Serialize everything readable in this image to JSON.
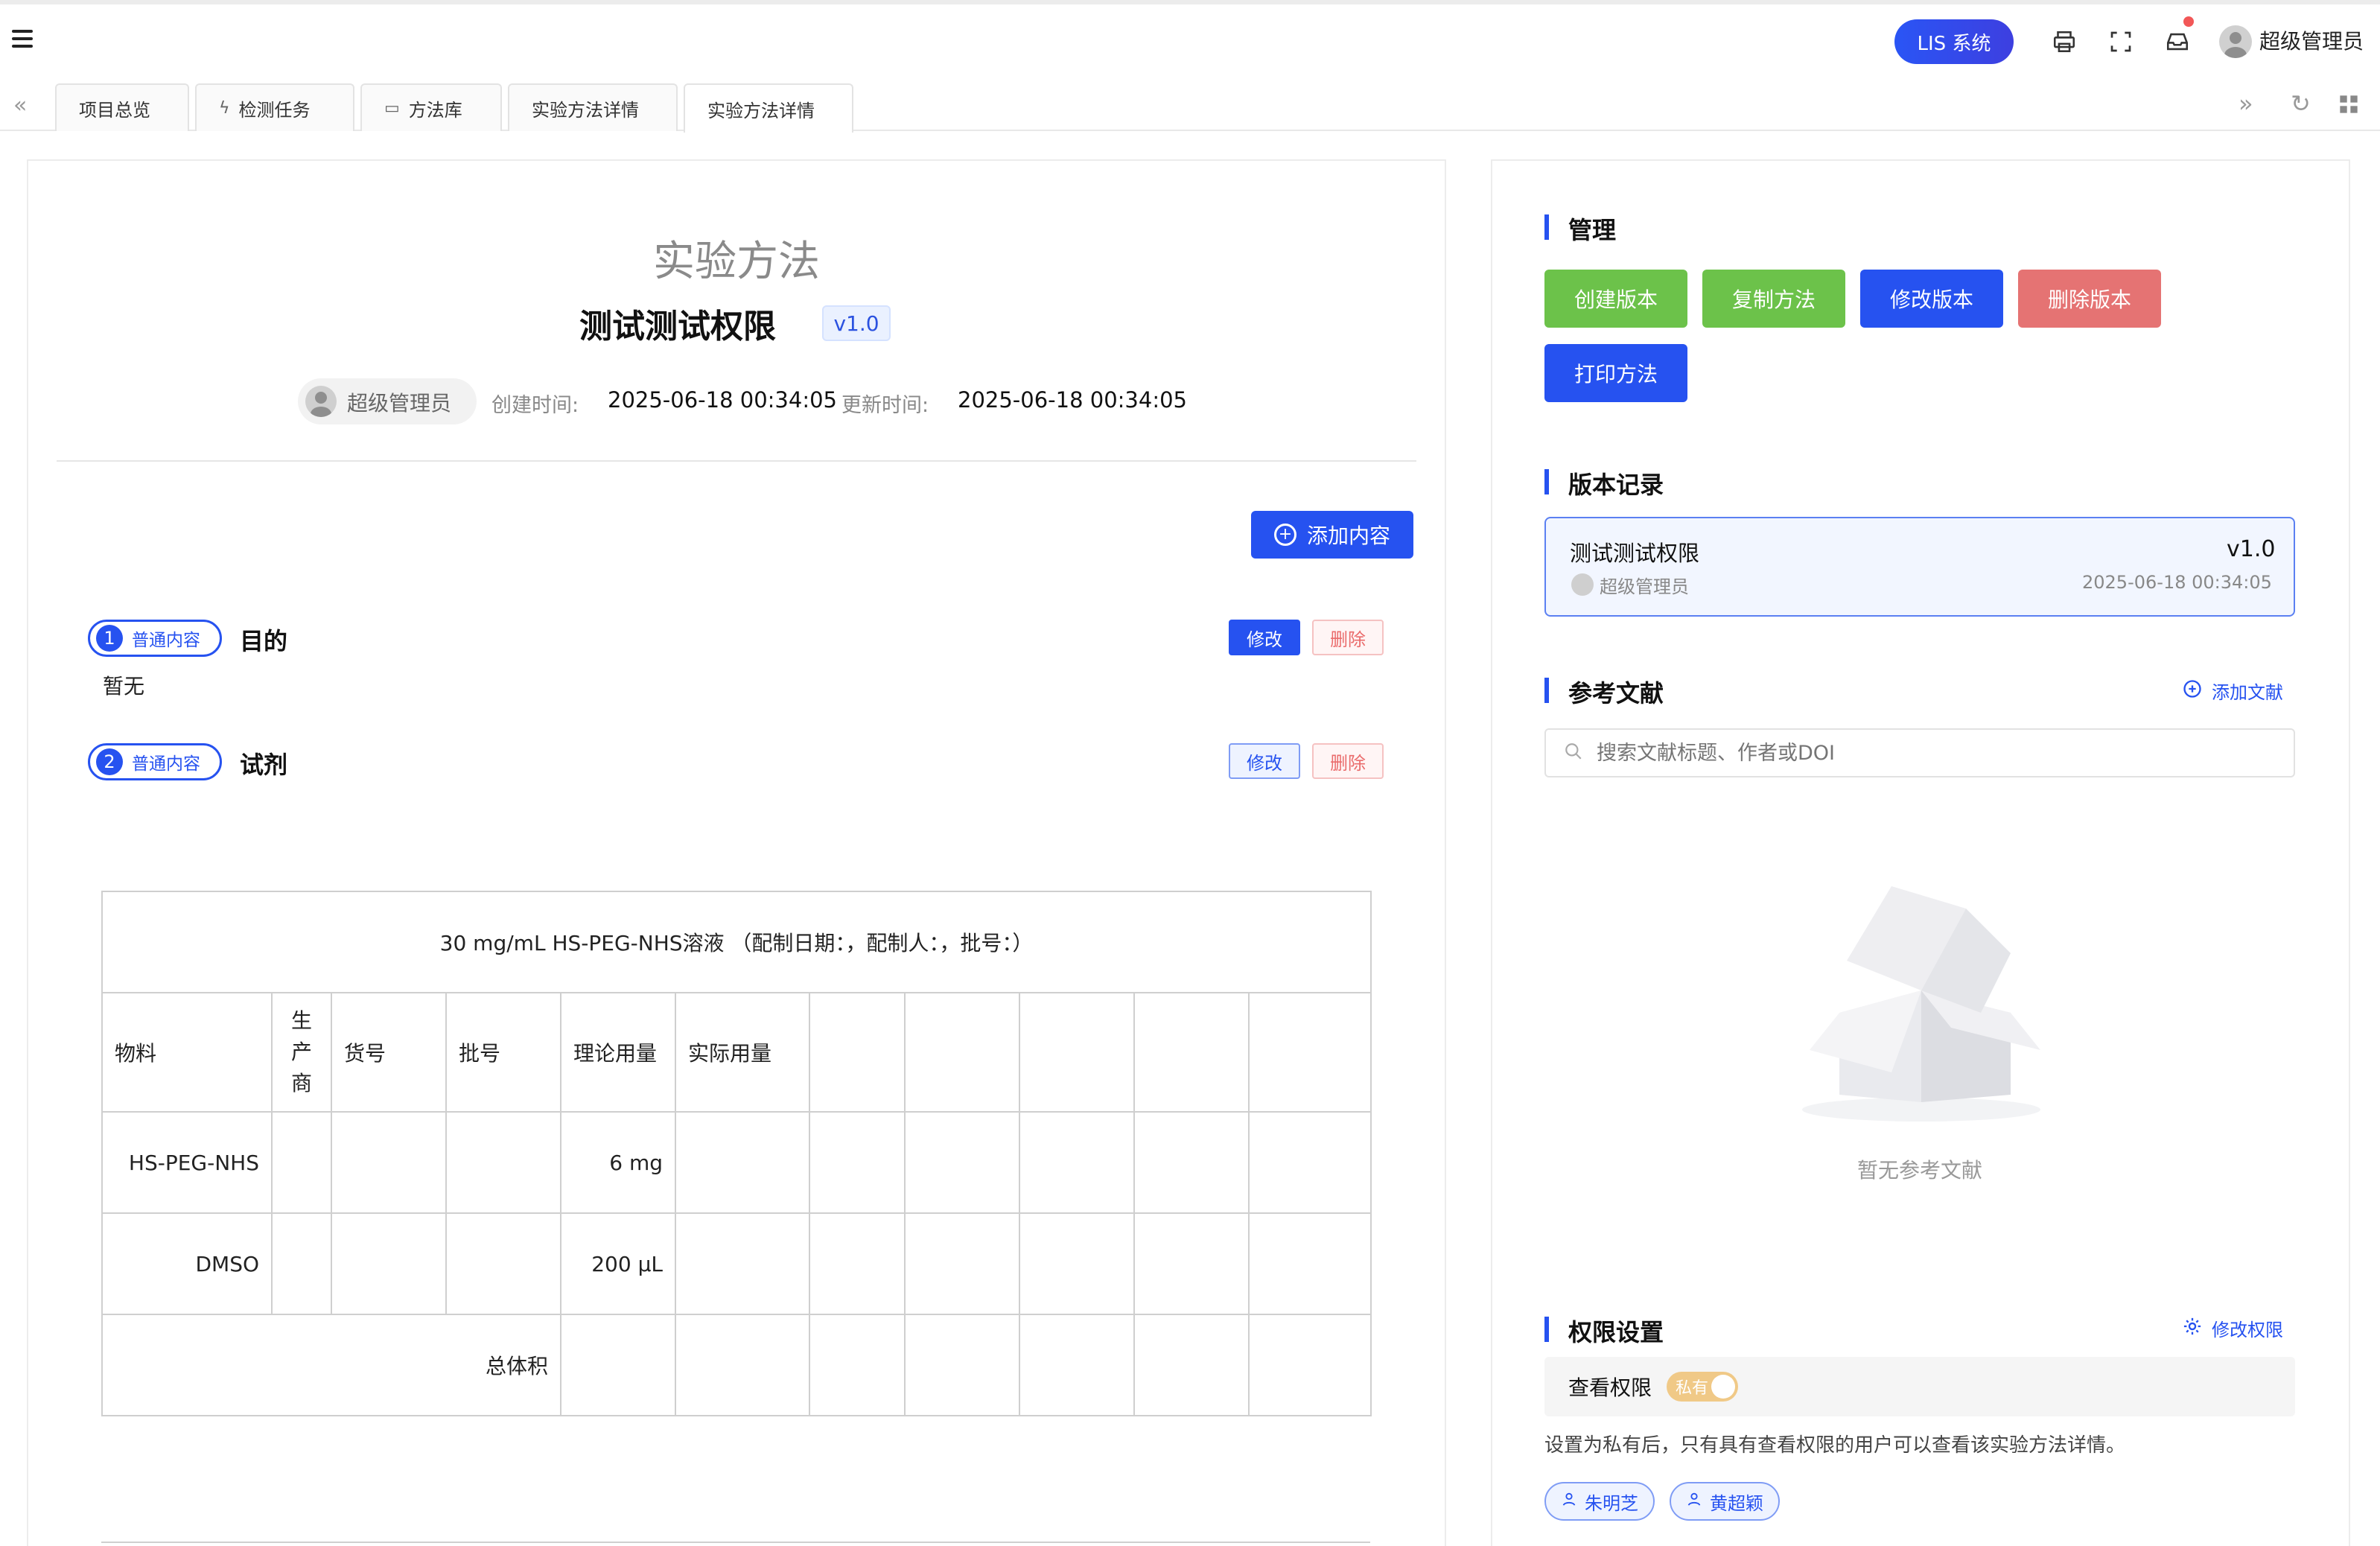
{
  "topbar": {
    "system_button": "LIS 系统",
    "user_name": "超级管理员"
  },
  "tabs": [
    {
      "label": "项目总览",
      "icon": ""
    },
    {
      "label": "检测任务",
      "icon": "lightning-icon"
    },
    {
      "label": "方法库",
      "icon": "box-icon"
    },
    {
      "label": "实验方法详情",
      "icon": ""
    },
    {
      "label": "实验方法详情",
      "icon": "",
      "active": true
    }
  ],
  "method": {
    "doc_title": "实验方法",
    "name": "测试测试权限",
    "version": "v1.0",
    "author": "超级管理员",
    "created_label": "创建时间:",
    "created_value": "2025-06-18 00:34:05",
    "updated_label": "更新时间:",
    "updated_value": "2025-06-18 00:34:05",
    "add_content_label": "添加内容"
  },
  "sections": [
    {
      "num": "1",
      "type": "普通内容",
      "title": "目的",
      "body": "暂无",
      "edit": "修改",
      "delete": "删除"
    },
    {
      "num": "2",
      "type": "普通内容",
      "title": "试剂",
      "edit": "修改",
      "delete": "删除"
    }
  ],
  "reagent_table": {
    "caption": "30 mg/mL HS-PEG-NHS溶液 （配制日期：，配制人：，批号：）",
    "headers": [
      "物料",
      "生\n产\n商",
      "货号",
      "批号",
      "理论用量",
      "实际用量",
      "",
      "",
      "",
      "",
      ""
    ],
    "rows": [
      [
        "HS-PEG-NHS",
        "",
        "",
        "",
        "6 mg",
        "",
        "",
        "",
        "",
        "",
        ""
      ],
      [
        "DMSO",
        "",
        "",
        "",
        "200 µL",
        "",
        "",
        "",
        "",
        "",
        ""
      ]
    ],
    "total_label": "总体积"
  },
  "management": {
    "title": "管理",
    "buttons": {
      "create_version": "创建版本",
      "copy_method": "复制方法",
      "edit_version": "修改版本",
      "delete_version": "删除版本",
      "print_method": "打印方法"
    }
  },
  "version_record": {
    "title": "版本记录",
    "items": [
      {
        "name": "测试测试权限",
        "version": "v1.0",
        "user": "超级管理员",
        "time": "2025-06-18 00:34:05"
      }
    ]
  },
  "references": {
    "title": "参考文献",
    "add_label": "添加文献",
    "search_placeholder": "搜索文献标题、作者或DOI",
    "empty_text": "暂无参考文献"
  },
  "permissions": {
    "title": "权限设置",
    "edit_label": "修改权限",
    "view_label": "查看权限",
    "toggle_label": "私有",
    "description": "设置为私有后，只有具有查看权限的用户可以查看该实验方法详情。",
    "users": [
      "朱明芝",
      "黄超颖"
    ]
  },
  "colors": {
    "primary": "#2652f0",
    "green": "#6cc24a",
    "red": "#e57373",
    "toggle": "#f0c987"
  }
}
